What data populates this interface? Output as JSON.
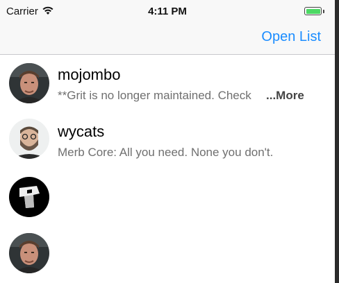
{
  "status_bar": {
    "carrier": "Carrier",
    "time": "4:11 PM",
    "battery_color": "#4cd964"
  },
  "nav": {
    "open_list_label": "Open List",
    "accent_color": "#1a8cff"
  },
  "list": {
    "items": [
      {
        "title": "mojombo",
        "subtitle": "**Grit is no longer maintained. Check",
        "more": "...More",
        "avatar": "avatar-photo"
      },
      {
        "title": "wycats",
        "subtitle": "Merb Core: All you need. None you don't.",
        "more": "",
        "avatar": "avatar-photo"
      },
      {
        "title": "",
        "subtitle": "",
        "more": "",
        "avatar": "avatar-logo"
      },
      {
        "title": "",
        "subtitle": "",
        "more": "",
        "avatar": "avatar-photo"
      }
    ]
  }
}
